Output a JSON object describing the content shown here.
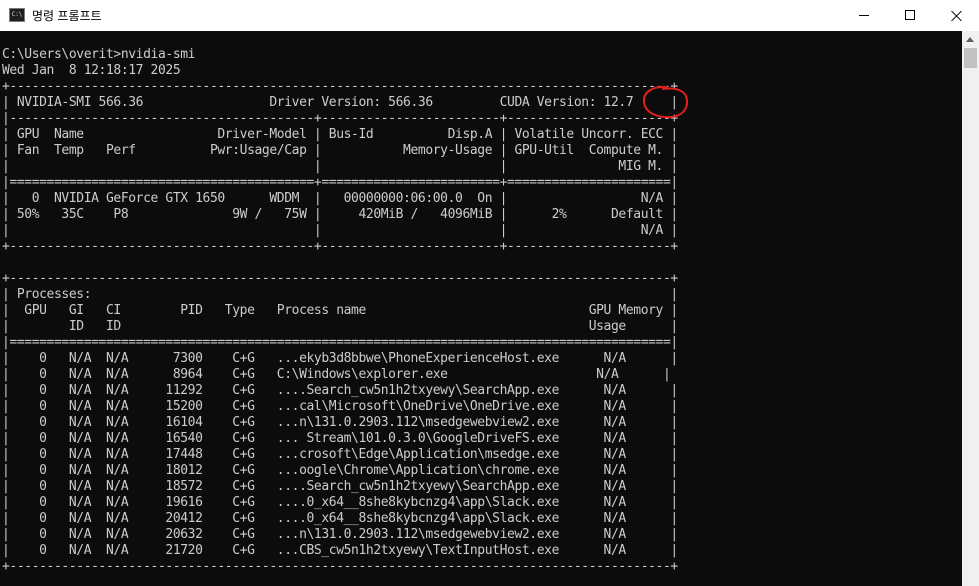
{
  "window": {
    "title": "명령 프롬프트",
    "icon": "cmd-icon",
    "icon_text": "C:\\",
    "controls": [
      "minimize",
      "maximize",
      "close"
    ]
  },
  "terminal": {
    "prompt_line": "C:\\Users\\overit>nvidia-smi",
    "timestamp_line": "Wed Jan  8 12:18:17 2025",
    "lines": [
      "+-----------------------------------------------------------------------------------------+",
      "| NVIDIA-SMI 566.36                 Driver Version: 566.36         CUDA Version: 12.7     |",
      "|-----------------------------------------+------------------------+----------------------+",
      "| GPU  Name                  Driver-Model | Bus-Id          Disp.A | Volatile Uncorr. ECC |",
      "| Fan  Temp   Perf          Pwr:Usage/Cap |           Memory-Usage | GPU-Util  Compute M. |",
      "|                                         |                        |               MIG M. |",
      "|=========================================+========================+======================|",
      "|   0  NVIDIA GeForce GTX 1650      WDDM  |   00000000:06:00.0  On |                  N/A |",
      "| 50%   35C    P8              9W /   75W |     420MiB /   4096MiB |      2%      Default |",
      "|                                         |                        |                  N/A |",
      "+-----------------------------------------+------------------------+----------------------+",
      "",
      "+-----------------------------------------------------------------------------------------+",
      "| Processes:                                                                              |",
      "|  GPU   GI   CI        PID   Type   Process name                              GPU Memory |",
      "|        ID   ID                                                               Usage      |",
      "|=========================================================================================|",
      "|    0   N/A  N/A      7300    C+G   ...ekyb3d8bbwe\\PhoneExperienceHost.exe      N/A      |",
      "|    0   N/A  N/A      8964    C+G   C:\\Windows\\explorer.exe                    N/A      |",
      "|    0   N/A  N/A     11292    C+G   ....Search_cw5n1h2txyewy\\SearchApp.exe      N/A      |",
      "|    0   N/A  N/A     15200    C+G   ...cal\\Microsoft\\OneDrive\\OneDrive.exe      N/A      |",
      "|    0   N/A  N/A     16104    C+G   ...n\\131.0.2903.112\\msedgewebview2.exe      N/A      |",
      "|    0   N/A  N/A     16540    C+G   ... Stream\\101.0.3.0\\GoogleDriveFS.exe      N/A      |",
      "|    0   N/A  N/A     17448    C+G   ...crosoft\\Edge\\Application\\msedge.exe      N/A      |",
      "|    0   N/A  N/A     18012    C+G   ...oogle\\Chrome\\Application\\chrome.exe      N/A      |",
      "|    0   N/A  N/A     18572    C+G   ....Search_cw5n1h2txyewy\\SearchApp.exe      N/A      |",
      "|    0   N/A  N/A     19616    C+G   ....0_x64__8she8kybcnzg4\\app\\Slack.exe      N/A      |",
      "|    0   N/A  N/A     20412    C+G   ....0_x64__8she8kybcnzg4\\app\\Slack.exe      N/A      |",
      "|    0   N/A  N/A     20632    C+G   ...n\\131.0.2903.112\\msedgewebview2.exe      N/A      |",
      "|    0   N/A  N/A     21720    C+G   ...CBS_cw5n1h2txyewy\\TextInputHost.exe      N/A      |",
      "+-----------------------------------------------------------------------------------------+"
    ]
  },
  "annotation": {
    "highlighted_value": "12.7",
    "color": "#e0201c"
  },
  "colors": {
    "background": "#0c0c0c",
    "text": "#cccccc",
    "titlebar": "#ffffff",
    "scrollbar": "#f0f0f0"
  },
  "scrollbar": {
    "position_fraction": 0.0
  }
}
